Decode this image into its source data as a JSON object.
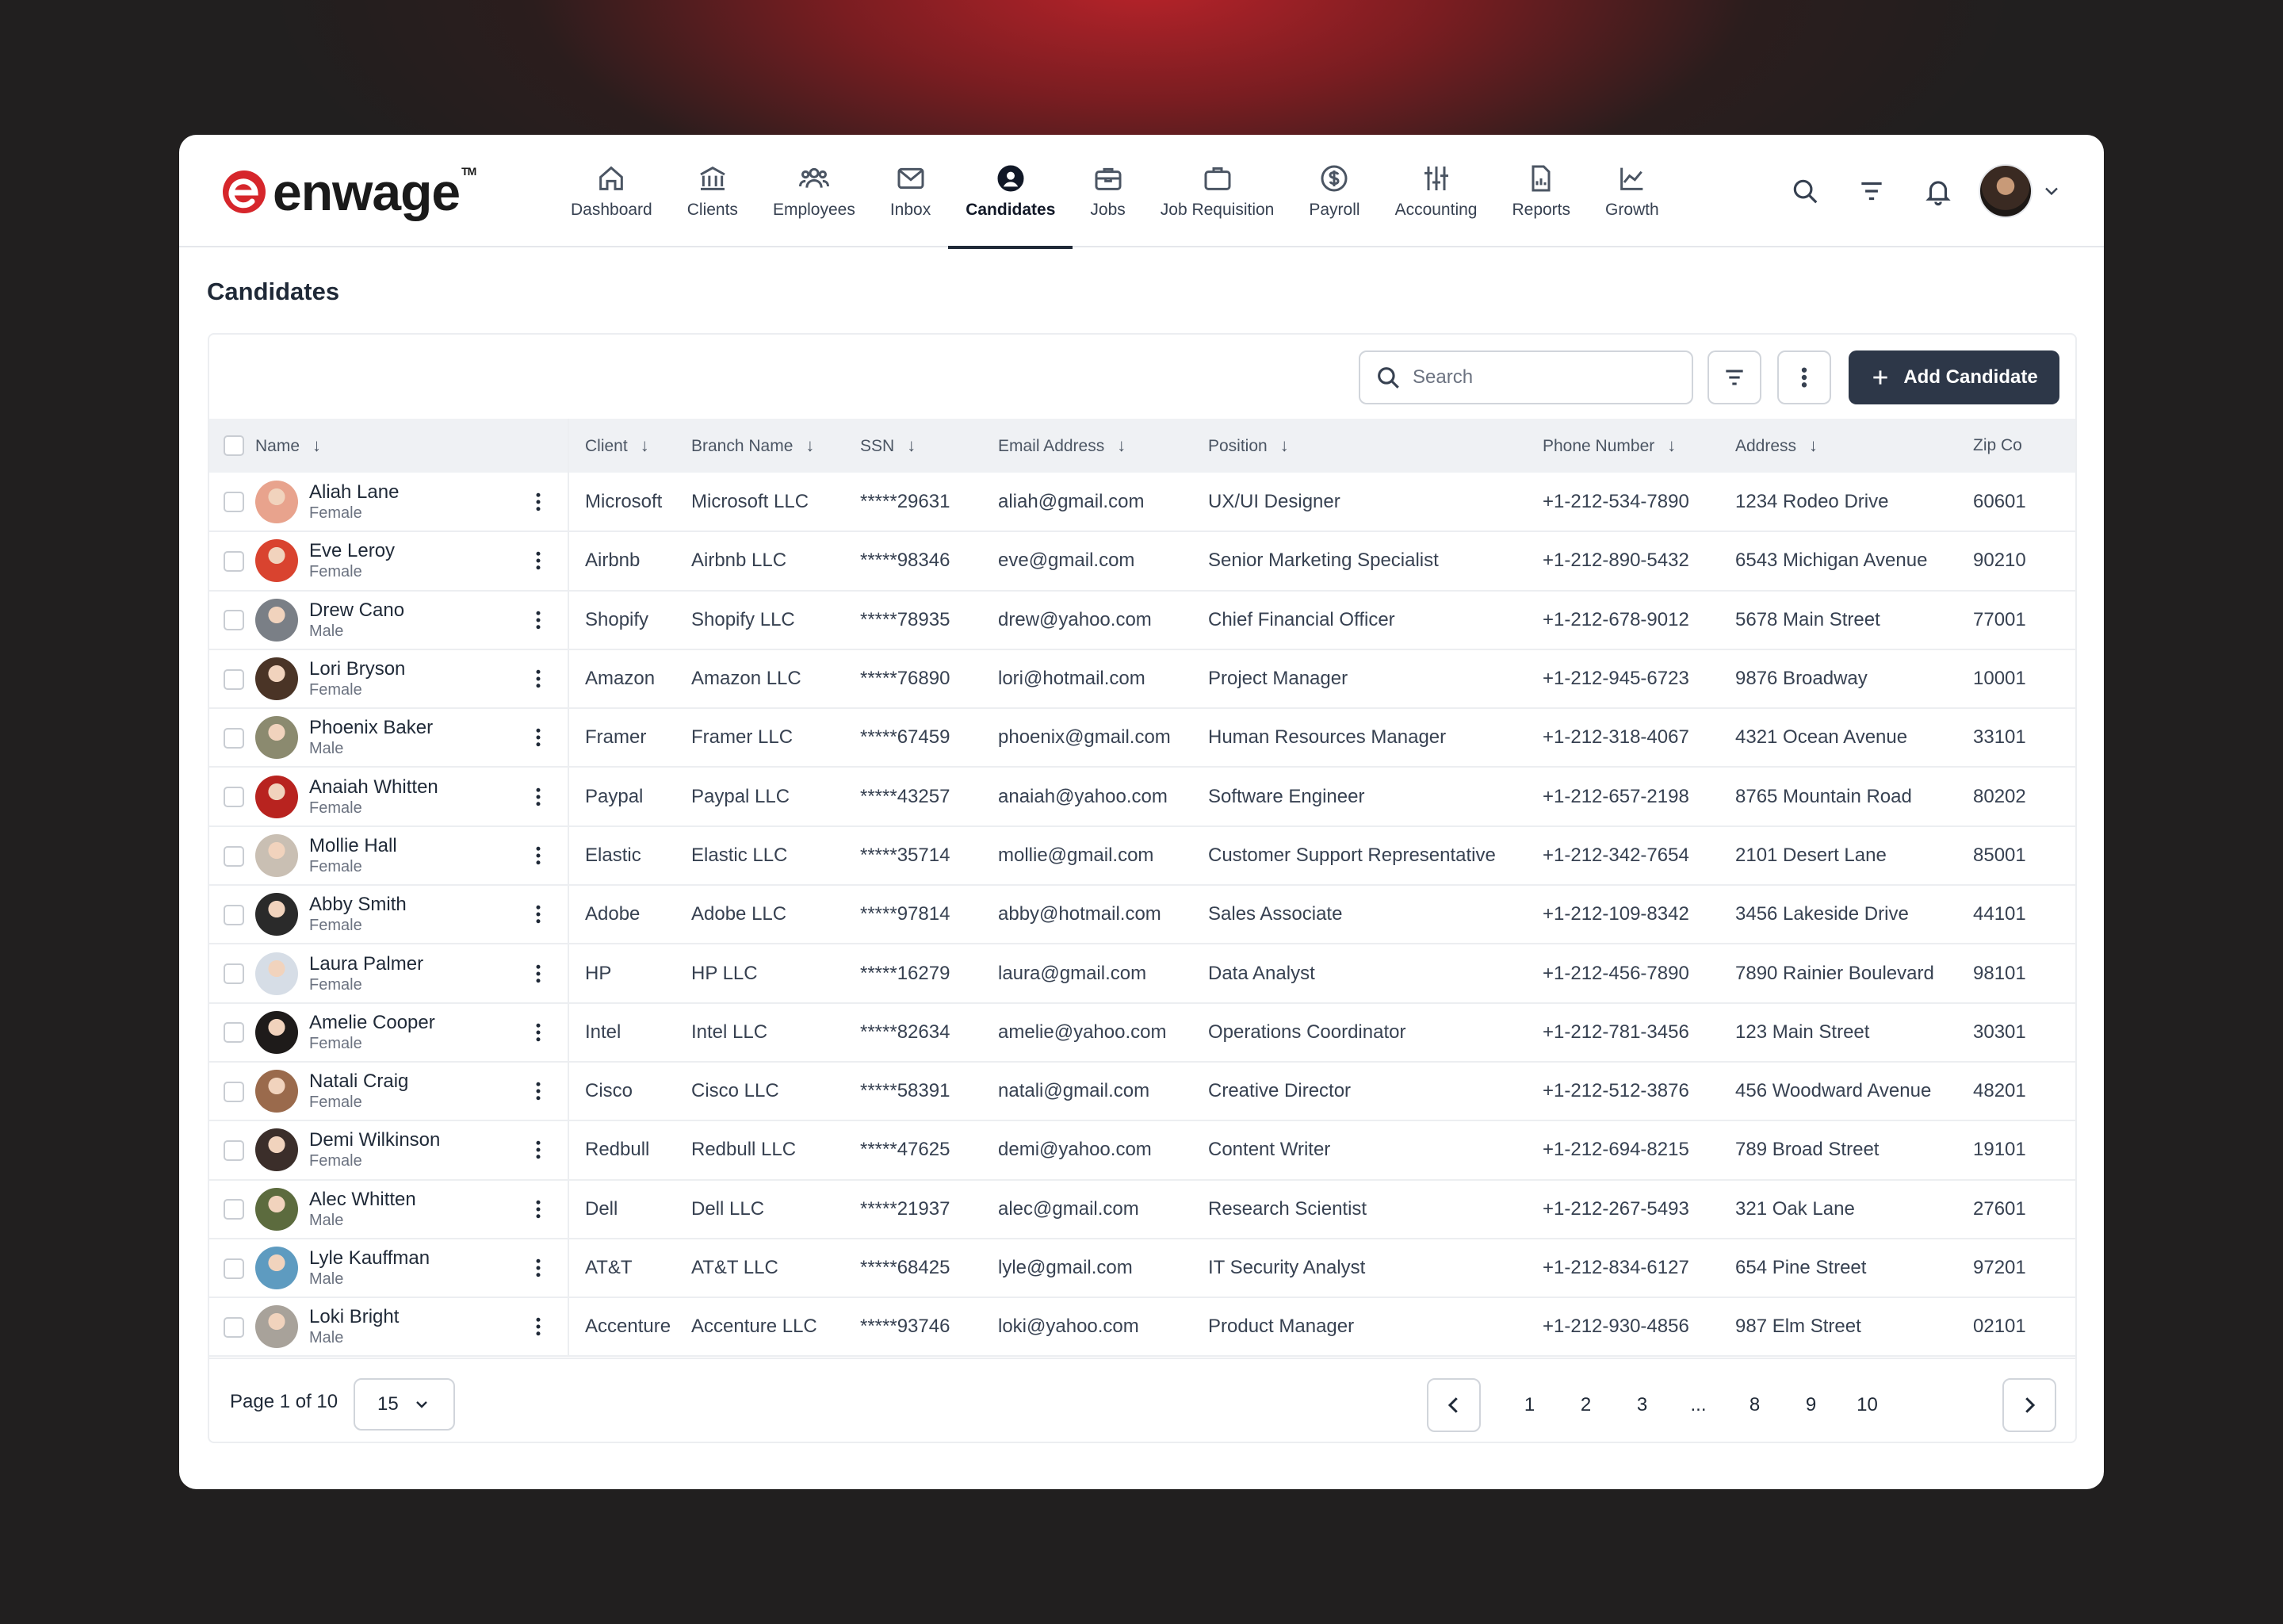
{
  "brand": {
    "name": "enwage",
    "tm": "TM"
  },
  "nav": [
    {
      "label": "Dashboard",
      "icon": "home-icon"
    },
    {
      "label": "Clients",
      "icon": "bank-icon"
    },
    {
      "label": "Employees",
      "icon": "users-icon"
    },
    {
      "label": "Inbox",
      "icon": "mail-icon"
    },
    {
      "label": "Candidates",
      "icon": "user-circle-icon",
      "active": true
    },
    {
      "label": "Jobs",
      "icon": "briefcase-icon"
    },
    {
      "label": "Job Requisition",
      "icon": "bag-icon"
    },
    {
      "label": "Payroll",
      "icon": "dollar-icon"
    },
    {
      "label": "Accounting",
      "icon": "sliders-icon"
    },
    {
      "label": "Reports",
      "icon": "report-icon"
    },
    {
      "label": "Growth",
      "icon": "chart-icon"
    }
  ],
  "page": {
    "title": "Candidates"
  },
  "toolbar": {
    "search_placeholder": "Search",
    "add_label": "Add Candidate"
  },
  "columns": [
    "Name",
    "Client",
    "Branch Name",
    "SSN",
    "Email Address",
    "Position",
    "Phone Number",
    "Address",
    "Zip Co"
  ],
  "rows": [
    {
      "name": "Aliah Lane",
      "gender": "Female",
      "client": "Microsoft",
      "branch": "Microsoft LLC",
      "ssn": "*****29631",
      "email": "aliah@gmail.com",
      "position": "UX/UI Designer",
      "phone": "+1-212-534-7890",
      "address": "1234 Rodeo Drive",
      "zip": "60601",
      "avatar": "#e8a38d"
    },
    {
      "name": "Eve Leroy",
      "gender": "Female",
      "client": "Airbnb",
      "branch": "Airbnb LLC",
      "ssn": "*****98346",
      "email": "eve@gmail.com",
      "position": "Senior Marketing Specialist",
      "phone": "+1-212-890-5432",
      "address": "6543 Michigan Avenue",
      "zip": "90210",
      "avatar": "#d9432f"
    },
    {
      "name": "Drew Cano",
      "gender": "Male",
      "client": "Shopify",
      "branch": "Shopify LLC",
      "ssn": "*****78935",
      "email": "drew@yahoo.com",
      "position": "Chief Financial Officer",
      "phone": "+1-212-678-9012",
      "address": "5678 Main Street",
      "zip": "77001",
      "avatar": "#7a7f86"
    },
    {
      "name": "Lori Bryson",
      "gender": "Female",
      "client": "Amazon",
      "branch": "Amazon LLC",
      "ssn": "*****76890",
      "email": "lori@hotmail.com",
      "position": "Project Manager",
      "phone": "+1-212-945-6723",
      "address": "9876 Broadway",
      "zip": "10001",
      "avatar": "#4a3426"
    },
    {
      "name": "Phoenix Baker",
      "gender": "Male",
      "client": "Framer",
      "branch": "Framer LLC",
      "ssn": "*****67459",
      "email": "phoenix@gmail.com",
      "position": "Human Resources Manager",
      "phone": "+1-212-318-4067",
      "address": "4321 Ocean Avenue",
      "zip": "33101",
      "avatar": "#8b8a6f"
    },
    {
      "name": "Anaiah Whitten",
      "gender": "Female",
      "client": "Paypal",
      "branch": "Paypal LLC",
      "ssn": "*****43257",
      "email": "anaiah@yahoo.com",
      "position": "Software Engineer",
      "phone": "+1-212-657-2198",
      "address": "8765 Mountain Road",
      "zip": "80202",
      "avatar": "#b8231f"
    },
    {
      "name": "Mollie Hall",
      "gender": "Female",
      "client": "Elastic",
      "branch": "Elastic LLC",
      "ssn": "*****35714",
      "email": "mollie@gmail.com",
      "position": "Customer Support Representative",
      "phone": "+1-212-342-7654",
      "address": "2101 Desert Lane",
      "zip": "85001",
      "avatar": "#c9bfb3"
    },
    {
      "name": "Abby Smith",
      "gender": "Female",
      "client": "Adobe",
      "branch": "Adobe LLC",
      "ssn": "*****97814",
      "email": "abby@hotmail.com",
      "position": "Sales Associate",
      "phone": "+1-212-109-8342",
      "address": "3456 Lakeside Drive",
      "zip": "44101",
      "avatar": "#2a2a2a"
    },
    {
      "name": "Laura Palmer",
      "gender": "Female",
      "client": "HP",
      "branch": "HP LLC",
      "ssn": "*****16279",
      "email": "laura@gmail.com",
      "position": "Data Analyst",
      "phone": "+1-212-456-7890",
      "address": "7890 Rainier Boulevard",
      "zip": "98101",
      "avatar": "#d6dde6"
    },
    {
      "name": "Amelie Cooper",
      "gender": "Female",
      "client": "Intel",
      "branch": "Intel LLC",
      "ssn": "*****82634",
      "email": "amelie@yahoo.com",
      "position": "Operations Coordinator",
      "phone": "+1-212-781-3456",
      "address": "123 Main Street",
      "zip": "30301",
      "avatar": "#1e1b1a"
    },
    {
      "name": "Natali Craig",
      "gender": "Female",
      "client": "Cisco",
      "branch": "Cisco LLC",
      "ssn": "*****58391",
      "email": "natali@gmail.com",
      "position": "Creative Director",
      "phone": "+1-212-512-3876",
      "address": "456 Woodward Avenue",
      "zip": "48201",
      "avatar": "#9a6a4c"
    },
    {
      "name": "Demi Wilkinson",
      "gender": "Female",
      "client": "Redbull",
      "branch": "Redbull LLC",
      "ssn": "*****47625",
      "email": "demi@yahoo.com",
      "position": "Content Writer",
      "phone": "+1-212-694-8215",
      "address": "789 Broad Street",
      "zip": "19101",
      "avatar": "#3b2e2a"
    },
    {
      "name": "Alec Whitten",
      "gender": "Male",
      "client": "Dell",
      "branch": "Dell LLC",
      "ssn": "*****21937",
      "email": "alec@gmail.com",
      "position": "Research Scientist",
      "phone": "+1-212-267-5493",
      "address": "321 Oak Lane",
      "zip": "27601",
      "avatar": "#5c6b3e"
    },
    {
      "name": "Lyle Kauffman",
      "gender": "Male",
      "client": "AT&T",
      "branch": "AT&T LLC",
      "ssn": "*****68425",
      "email": "lyle@gmail.com",
      "position": "IT Security Analyst",
      "phone": "+1-212-834-6127",
      "address": "654 Pine Street",
      "zip": "97201",
      "avatar": "#5e9bc0"
    },
    {
      "name": "Loki Bright",
      "gender": "Male",
      "client": "Accenture",
      "branch": "Accenture LLC",
      "ssn": "*****93746",
      "email": "loki@yahoo.com",
      "position": "Product Manager",
      "phone": "+1-212-930-4856",
      "address": "987 Elm Street",
      "zip": "02101",
      "avatar": "#a8a29a"
    }
  ],
  "pagination": {
    "info": "Page 1 of 10",
    "per_page": "15",
    "pages": [
      "1",
      "2",
      "3",
      "...",
      "8",
      "9",
      "10"
    ]
  }
}
